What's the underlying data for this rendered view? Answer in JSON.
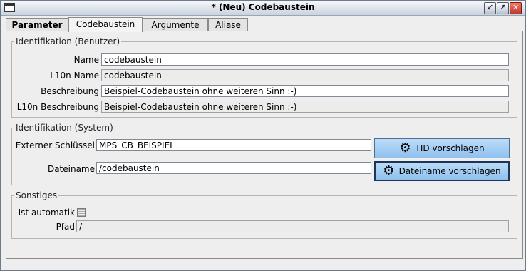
{
  "window": {
    "title": "* (Neu) Codebaustein"
  },
  "tabs": [
    {
      "label": "Parameter"
    },
    {
      "label": "Codebaustein"
    },
    {
      "label": "Argumente"
    },
    {
      "label": "Aliase"
    }
  ],
  "ident_user": {
    "legend": "Identifikation (Benutzer)",
    "name_label": "Name",
    "name_value": "codebaustein",
    "l10n_name_label": "L10n Name",
    "l10n_name_value": "codebaustein",
    "desc_label": "Beschreibung",
    "desc_value": "Beispiel-Codebaustein ohne weiteren Sinn :-)",
    "l10n_desc_label": "L10n Beschreibung",
    "l10n_desc_value": "Beispiel-Codebaustein ohne weiteren Sinn :-)"
  },
  "ident_system": {
    "legend": "Identifikation (System)",
    "ext_key_label": "Externer Schlüssel",
    "ext_key_value": "MPS_CB_BEISPIEL",
    "filename_label": "Dateiname",
    "filename_value": "/codebaustein",
    "tid_button": "TID vorschlagen",
    "filename_button": "Dateiname vorschlagen"
  },
  "other": {
    "legend": "Sonstiges",
    "auto_label": "Ist automatik",
    "path_label": "Pfad",
    "path_value": "/"
  },
  "icons": {
    "gear": "gear-icon",
    "window": "window-menu-icon"
  }
}
